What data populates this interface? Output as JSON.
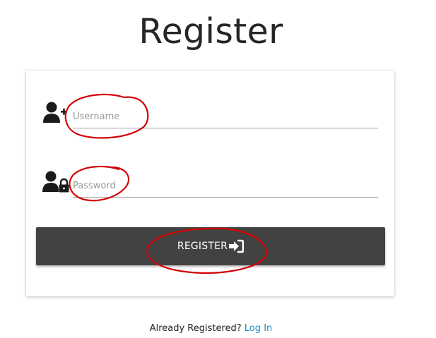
{
  "page": {
    "title": "Register"
  },
  "form": {
    "username": {
      "placeholder": "Username",
      "value": "",
      "icon": "user-plus-icon"
    },
    "password": {
      "placeholder": "Password",
      "value": "",
      "icon": "user-lock-icon"
    },
    "submit": {
      "label": "REGISTER",
      "icon": "sign-in-icon"
    }
  },
  "footer": {
    "prompt": "Already Registered?",
    "link_label": "Log In"
  },
  "annotations": {
    "color": "#d40000"
  }
}
